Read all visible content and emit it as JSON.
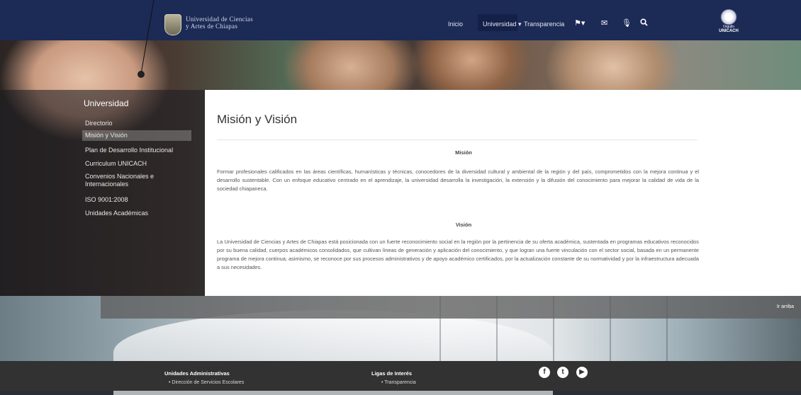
{
  "brand": {
    "line1": "Universidad de Ciencias",
    "line2": "y Artes de Chiapas"
  },
  "nav": {
    "inicio": "Inicio",
    "universidad": "Universidad ▾",
    "transparencia": "Transparencia",
    "icons": [
      "flag-icon",
      "envelope-icon",
      "microphone-icon",
      "search-icon"
    ]
  },
  "orgullo": {
    "line1": "Orgullo",
    "line2": "UNICACH"
  },
  "sidebar": {
    "title": "Universidad",
    "items": [
      {
        "label": "Directorio"
      },
      {
        "label": "Misión y Visión"
      },
      {
        "label": "Plan de Desarrollo Institucional"
      },
      {
        "label": "Curriculum UNICACH"
      },
      {
        "label": "Convenios Nacionales e Internacionales"
      },
      {
        "label": "ISO 9001:2008"
      },
      {
        "label": "Unidades Académicas"
      }
    ]
  },
  "content": {
    "title": "Misión y Visión",
    "mision_title": "Misión",
    "mision_text": "Formar profesionales calificados en las áreas científicas, humanísticas y técnicas, conocedores de la diversidad cultural y ambiental de la región y del país, comprometidos con la mejora continua y el desarrollo sustentable. Con un enfoque educativo centrado en el aprendizaje, la universidad desarrolla la investigación, la extensión y la difusión del conocimiento para mejorar la calidad de vida de la sociedad chiapaneca.",
    "vision_title": "Visión",
    "vision_text": "La Universidad de Ciencias y Artes de Chiapas está posicionada con un fuerte reconocimiento social en la región por la pertinencia de su oferta académica, sustentada en programas educativos reconocidos por su buena calidad, cuerpos académicos consolidados, que cultivan líneas de generación y aplicación del conocimiento, y que logran una fuerte vinculación con el sector social, basada en un permanente programa de mejora continua; asimismo, se reconoce por sus procesos administrativos y de apoyo académico certificados, por la actualización constante de su normatividad y por la infraestructura adecuada a sus necesidades."
  },
  "upbar": {
    "label": "Ir arriba"
  },
  "footer": {
    "col1": {
      "title": "Unidades Administrativas",
      "link1": "• Dirección de Servicios Escolares"
    },
    "col2": {
      "title": "Ligas de Interés",
      "link1": "• Transparencia"
    },
    "social": [
      "facebook-icon",
      "twitter-icon",
      "youtube-icon"
    ]
  }
}
